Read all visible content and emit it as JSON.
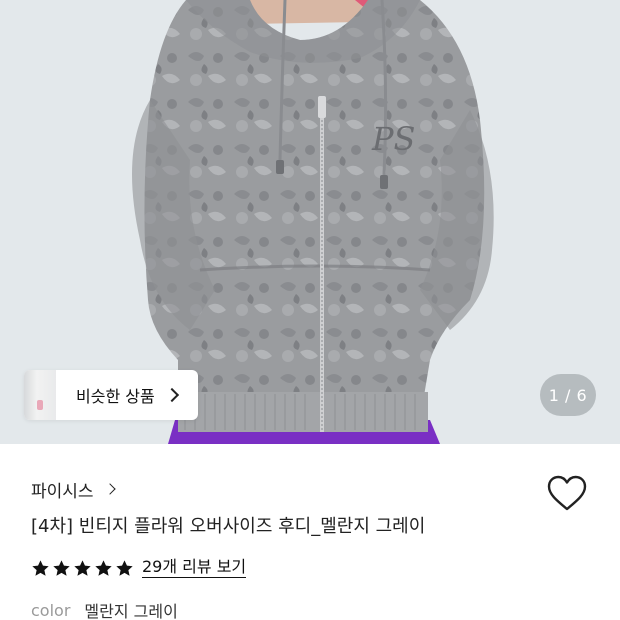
{
  "gallery": {
    "similar_label": "비슷한 상품",
    "counter": "1 / 6",
    "brand_mark": "PS"
  },
  "product": {
    "brand": "파이시스",
    "title": "[4차] 빈티지 플라워 오버사이즈 후디_멜란지 그레이",
    "rating_stars": 5,
    "review_link": "29개 리뷰 보기",
    "option_key": "color",
    "option_value": "멜란지 그레이"
  },
  "colors": {
    "hoodie": "#9a9c9f",
    "pants": "#7a2fc4",
    "star": "#111111",
    "heart_outline": "#222222"
  },
  "icons": {
    "heart": "heart-icon",
    "star": "star-icon",
    "chevron": "chevron-right-icon"
  }
}
